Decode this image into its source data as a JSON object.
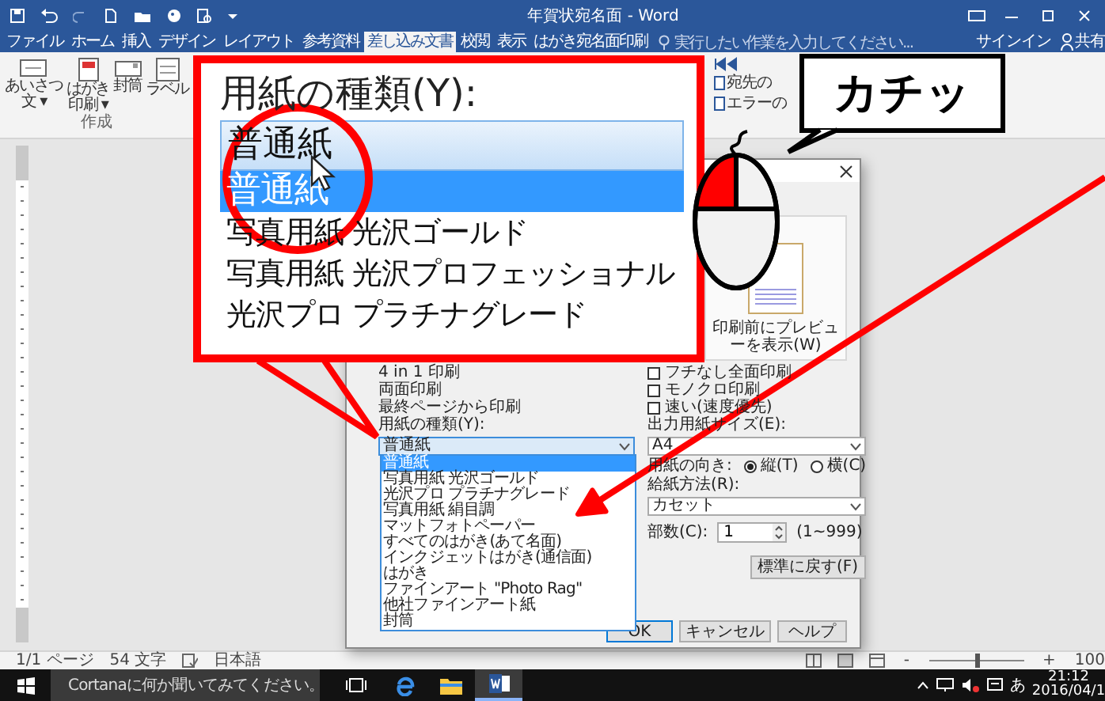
{
  "title_bar": {
    "title": "年賀状宛名面 - Word"
  },
  "ribbon_tabs": [
    {
      "label": "ファイル",
      "selected": false
    },
    {
      "label": "ホーム",
      "selected": false
    },
    {
      "label": "挿入",
      "selected": false
    },
    {
      "label": "デザイン",
      "selected": false
    },
    {
      "label": "レイアウト",
      "selected": false
    },
    {
      "label": "参考資料",
      "selected": false
    },
    {
      "label": "差し込み文書",
      "selected": true
    },
    {
      "label": "校閲",
      "selected": false
    },
    {
      "label": "表示",
      "selected": false
    },
    {
      "label": "はがき宛名面印刷",
      "selected": false
    }
  ],
  "tell_me": {
    "placeholder": "実行したい作業を入力してください..."
  },
  "account": {
    "sign_in": "サインイン",
    "share": "共有"
  },
  "ribbon": {
    "create_group": {
      "label": "作成",
      "buttons": [
        {
          "lines": [
            "あいさつ",
            "文 ▾"
          ],
          "kind": "greeting"
        },
        {
          "lines": [
            "はがき",
            "印刷 ▾"
          ],
          "kind": "postcard"
        },
        {
          "lines": [
            "封筒"
          ],
          "kind": "envelope"
        },
        {
          "lines": [
            "ラベル"
          ],
          "kind": "label"
        }
      ]
    },
    "preview_items": [
      "宛先の",
      "エラーの"
    ]
  },
  "callout": {
    "label": "用紙の種類(Y):",
    "value": "普通紙",
    "options": [
      {
        "label": "普通紙",
        "selected": true
      },
      {
        "label": "写真用紙 光沢ゴールド",
        "selected": false
      },
      {
        "label": "写真用紙 光沢プロフェッショナル",
        "selected": false
      },
      {
        "label": "光沢プロ プラチナグレード",
        "selected": false
      }
    ]
  },
  "speech_bubble": {
    "text": "カチッ"
  },
  "dialog": {
    "preview_label": "印刷前にプレビューを表示(W)",
    "options": [
      {
        "label": "4 in 1 印刷",
        "kind": "label"
      },
      {
        "label": "フチなし全面印刷",
        "kind": "checkbox",
        "checked": false
      },
      {
        "label": "両面印刷",
        "kind": "label"
      },
      {
        "label": "モノクロ印刷",
        "kind": "checkbox",
        "checked": false
      },
      {
        "label": "最終ページから印刷",
        "kind": "label"
      },
      {
        "label": "速い(速度優先)",
        "kind": "checkbox",
        "checked": false
      }
    ],
    "paper_type": {
      "label": "用紙の種類(Y):",
      "value": "普通紙",
      "options": [
        {
          "label": "普通紙",
          "selected": true
        },
        {
          "label": "写真用紙 光沢ゴールド",
          "selected": false
        },
        {
          "label": "光沢プロ プラチナグレード",
          "selected": false
        },
        {
          "label": "写真用紙 絹目調",
          "selected": false
        },
        {
          "label": "マットフォトペーパー",
          "selected": false
        },
        {
          "label": "すべてのはがき(あて名面)",
          "selected": false
        },
        {
          "label": "インクジェットはがき(通信面)",
          "selected": false
        },
        {
          "label": "はがき",
          "selected": false
        },
        {
          "label": "ファインアート \"Photo Rag\"",
          "selected": false
        },
        {
          "label": "他社ファインアート紙",
          "selected": false
        },
        {
          "label": "封筒",
          "selected": false
        }
      ]
    },
    "output_size": {
      "label": "出力用紙サイズ(E):",
      "value": "A4"
    },
    "orientation": {
      "label": "用紙の向き:",
      "options": [
        {
          "label": "縦(T)",
          "selected": true
        },
        {
          "label": "横(C)",
          "selected": false
        }
      ]
    },
    "paper_source": {
      "label": "給紙方法(R):",
      "value": "カセット"
    },
    "copies": {
      "label": "部数(C):",
      "value": "1",
      "range": "(1~999)"
    },
    "reset_button": "標準に戻す(F)",
    "buttons": [
      "OK",
      "キャンセル",
      "ヘルプ"
    ]
  },
  "status_bar": {
    "page": "1/1 ページ",
    "words": "54 文字",
    "language": "日本語",
    "zoom_out": "-",
    "zoom_in": "+",
    "zoom_slider": {
      "level": 0.5
    },
    "zoom": "100"
  },
  "taskbar": {
    "search_placeholder": "Cortanaに何か聞いてみてください。",
    "ime": "あ",
    "time": "21:12",
    "date": "2016/04/1"
  }
}
